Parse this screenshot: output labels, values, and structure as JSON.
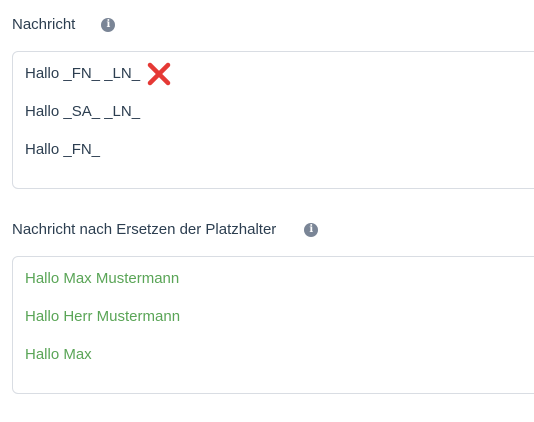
{
  "message": {
    "label": "Nachricht",
    "lines": [
      "Hallo _FN_ _LN_",
      "Hallo _SA_ _LN_",
      "Hallo _FN_"
    ]
  },
  "result": {
    "label": "Nachricht nach Ersetzen der Platzhalter",
    "lines": [
      "Hallo Max Mustermann",
      "Hallo Herr Mustermann",
      "Hallo Max"
    ]
  },
  "icons": {
    "info": "i",
    "error_mark": "x-mark-icon"
  },
  "colors": {
    "template_text": "#2c3e50",
    "result_text": "#5aa557",
    "error": "#e53935",
    "info_icon": "#7a8596"
  }
}
